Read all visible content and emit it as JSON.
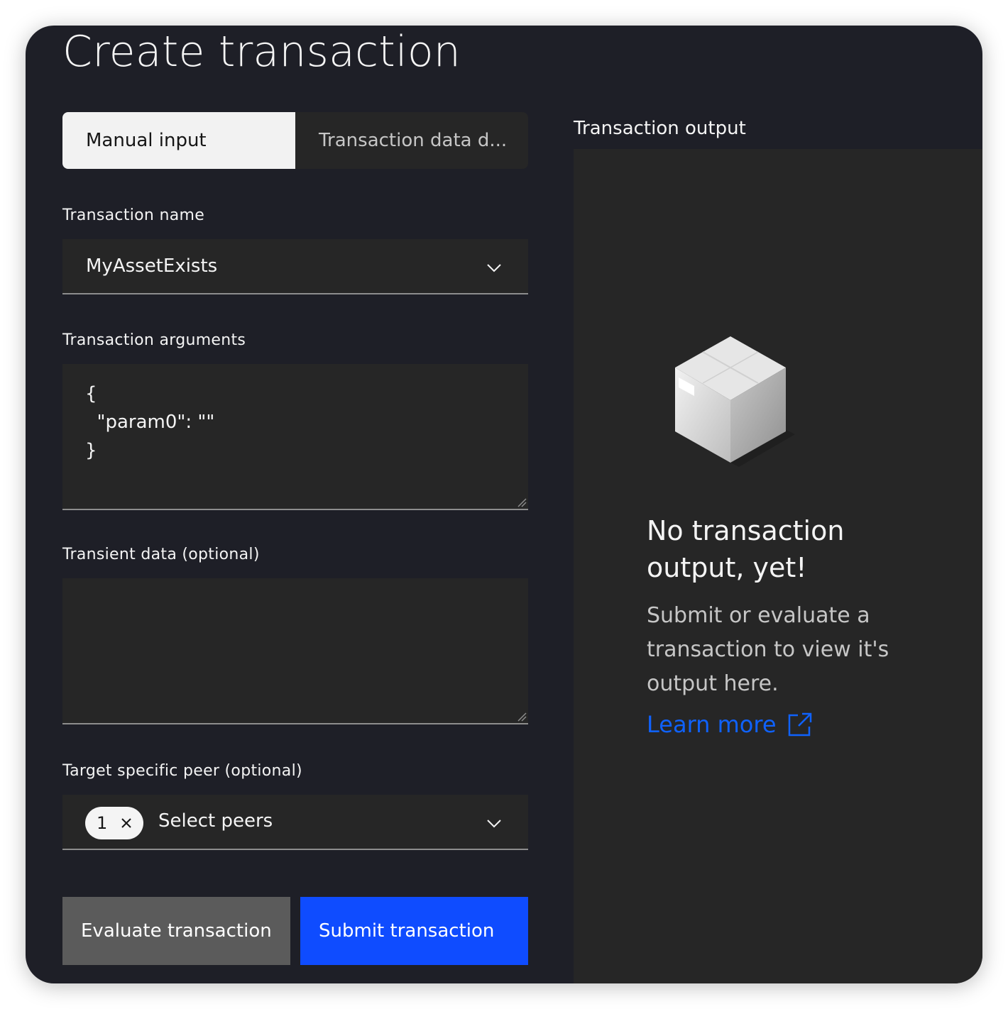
{
  "page": {
    "title": "Create transaction"
  },
  "tabs": [
    {
      "label": "Manual input",
      "active": true
    },
    {
      "label": "Transaction data d...",
      "active": false
    }
  ],
  "form": {
    "transaction_name": {
      "label": "Transaction name",
      "value": "MyAssetExists"
    },
    "transaction_arguments": {
      "label": "Transaction arguments",
      "value": "{\n  \"param0\": \"\"\n}"
    },
    "transient_data": {
      "label": "Transient data (optional)",
      "value": ""
    },
    "target_peer": {
      "label": "Target specific peer (optional)",
      "selected_count": "1",
      "placeholder": "Select peers"
    }
  },
  "buttons": {
    "evaluate": "Evaluate transaction",
    "submit": "Submit transaction"
  },
  "output": {
    "label": "Transaction output",
    "empty_title": "No transaction output, yet!",
    "empty_body": "Submit or evaluate a transaction to view it's output here.",
    "learn_more": "Learn more"
  },
  "colors": {
    "background": "#1e1f27",
    "panel": "#262626",
    "accent": "#0f62fe",
    "submit": "#0f4cff",
    "evaluate": "#5b5b5b"
  },
  "icons": [
    "chevron-down-icon",
    "close-icon",
    "package-box-icon",
    "external-link-icon",
    "resize-handle-icon"
  ]
}
